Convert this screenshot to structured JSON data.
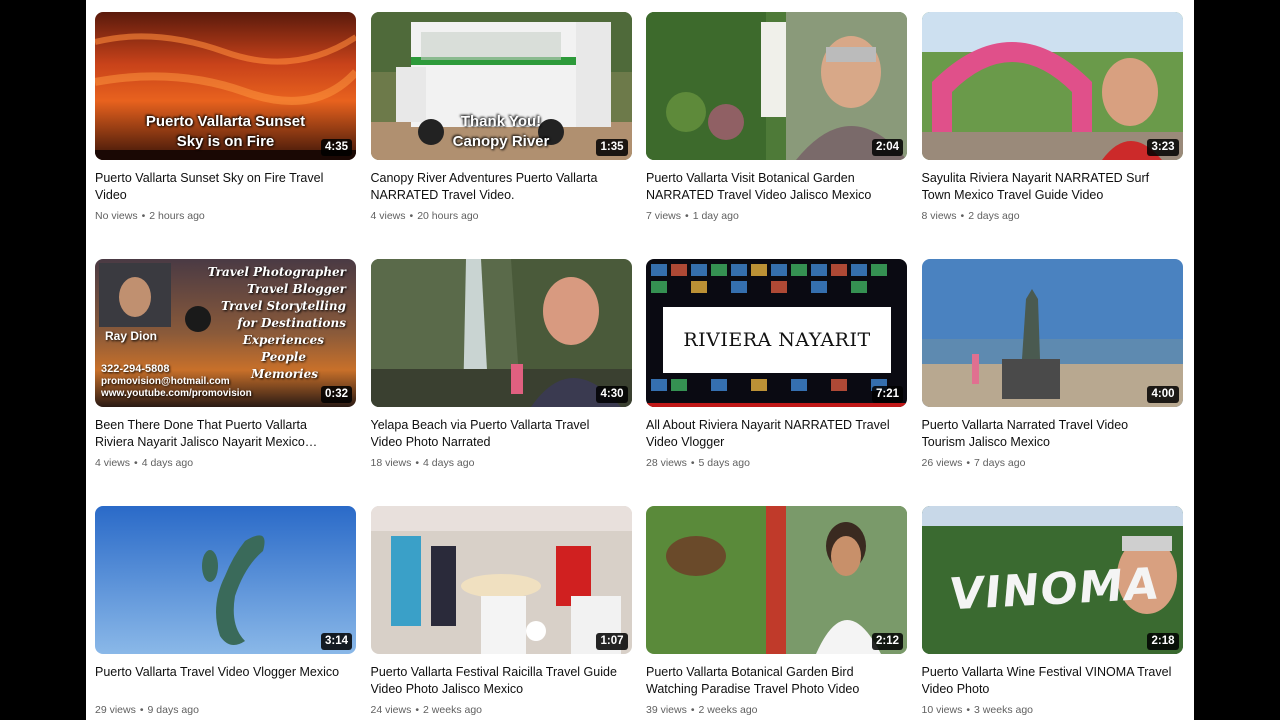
{
  "videos": [
    {
      "title": "Puerto Vallarta Sunset Sky on Fire Travel Video",
      "views": "No views",
      "age": "2 hours ago",
      "duration": "4:35",
      "overlay": "Puerto Vallarta Sunset\nSky is on Fire"
    },
    {
      "title": "Canopy River Adventures Puerto Vallarta NARRATED Travel Video.",
      "views": "4 views",
      "age": "20 hours ago",
      "duration": "1:35",
      "overlay": "Thank You!\nCanopy River"
    },
    {
      "title": "Puerto Vallarta Visit Botanical Garden NARRATED Travel Video Jalisco Mexico",
      "views": "7 views",
      "age": "1 day ago",
      "duration": "2:04"
    },
    {
      "title": "Sayulita Riviera Nayarit NARRATED Surf Town Mexico Travel Guide Video",
      "views": "8 views",
      "age": "2 days ago",
      "duration": "3:23"
    },
    {
      "title": "Been There Done That Puerto Vallarta Riviera Nayarit Jalisco Nayarit Mexico Trav…",
      "views": "4 views",
      "age": "4 days ago",
      "duration": "0:32",
      "card": {
        "lines": [
          "Travel Photographer",
          "Travel Blogger",
          "Travel Storytelling",
          "for Destinations",
          "Experiences",
          "People",
          "Memories"
        ],
        "name": "Ray Dion",
        "phone": "322-294-5808",
        "email": "promovision@hotmail.com",
        "web": "www.youtube.com/promovision"
      }
    },
    {
      "title": "Yelapa Beach via Puerto Vallarta Travel Video Photo Narrated",
      "views": "18 views",
      "age": "4 days ago",
      "duration": "4:30"
    },
    {
      "title": "All About Riviera Nayarit NARRATED Travel Video Vlogger",
      "views": "28 views",
      "age": "5 days ago",
      "duration": "7:21",
      "logo": "RIVIERA NAYARIT"
    },
    {
      "title": "Puerto Vallarta Narrated Travel Video Tourism Jalisco Mexico",
      "views": "26 views",
      "age": "7 days ago",
      "duration": "4:00"
    },
    {
      "title": "Puerto Vallarta Travel Video Vlogger Mexico",
      "views": "29 views",
      "age": "9 days ago",
      "duration": "3:14"
    },
    {
      "title": "Puerto Vallarta Festival Raicilla Travel Guide Video Photo Jalisco Mexico",
      "views": "24 views",
      "age": "2 weeks ago",
      "duration": "1:07"
    },
    {
      "title": "Puerto Vallarta Botanical Garden Bird Watching Paradise Travel Photo Video",
      "views": "39 views",
      "age": "2 weeks ago",
      "duration": "2:12"
    },
    {
      "title": "Puerto Vallarta Wine Festival VINOMA Travel Video Photo",
      "views": "10 views",
      "age": "3 weeks ago",
      "duration": "2:18",
      "sign": "VINOMA"
    }
  ],
  "colors": {
    "title": "#0f0f0f",
    "meta": "#606060",
    "duration_bg": "#000000"
  }
}
